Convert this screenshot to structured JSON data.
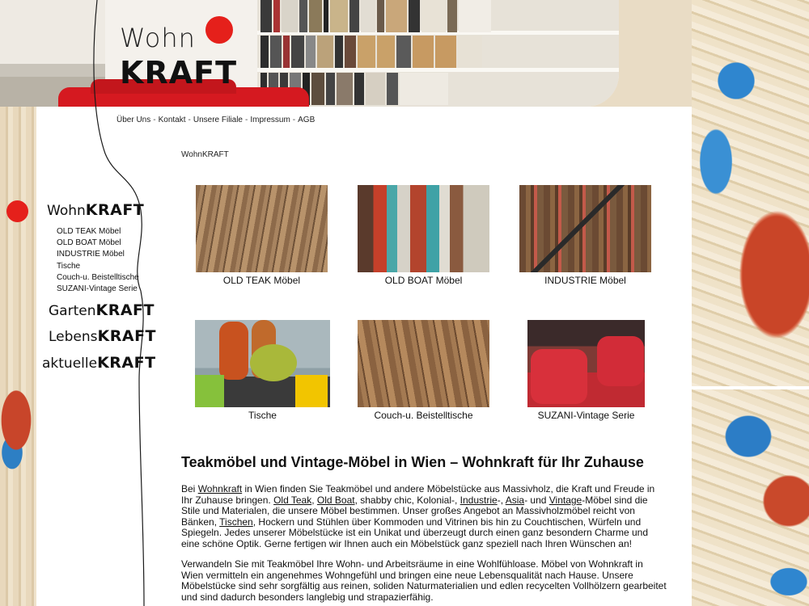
{
  "header": {
    "logo_wohn": "Wohn",
    "logo_kraft": "KRAFT"
  },
  "topnav": {
    "items": [
      {
        "label": "Über Uns"
      },
      {
        "label": "Kontakt"
      },
      {
        "label": "Unsere Filiale"
      },
      {
        "label": "Impressum"
      },
      {
        "label": "AGB"
      }
    ],
    "separator": "-"
  },
  "breadcrumb": "WohnKRAFT",
  "sidebar": {
    "wohn": {
      "thin": "Wohn",
      "bold": "KRAFT"
    },
    "sub_items": [
      "OLD TEAK Möbel",
      "OLD BOAT Möbel",
      "INDUSTRIE Möbel",
      "Tische",
      "Couch-u. Beistelltische",
      "SUZANI-Vintage Serie"
    ],
    "garten": {
      "thin": "Garten",
      "bold": "KRAFT"
    },
    "lebens": {
      "thin": "Lebens",
      "bold": "KRAFT"
    },
    "aktuelle": {
      "thin": "aktuelle",
      "bold": "KRAFT"
    }
  },
  "gallery": [
    {
      "caption": "OLD TEAK Möbel"
    },
    {
      "caption": "OLD BOAT Möbel"
    },
    {
      "caption": "INDUSTRIE Möbel"
    },
    {
      "caption": "Tische"
    },
    {
      "caption": "Couch-u. Beistelltische"
    },
    {
      "caption": "SUZANI-Vintage Serie"
    }
  ],
  "article": {
    "title": "Teakmöbel und Vintage-Möbel in Wien – Wohnkraft für Ihr Zuhause",
    "p1": {
      "t1": "Bei ",
      "l1": "Wohnkraft",
      "t2": " in Wien finden Sie Teakmöbel und andere Möbelstücke aus Massivholz, die Kraft und Freude in Ihr Zuhause bringen. ",
      "l2": "Old Teak",
      "t3": ", ",
      "l3": "Old Boat",
      "t4": ", shabby chic, Kolonial-, ",
      "l4": "Industrie",
      "t5": "-, ",
      "l5": "Asia",
      "t6": "- und ",
      "l6": "Vintage",
      "t7": "-Möbel sind die Stile und Materialen, die unsere Möbel bestimmen. Unser großes Angebot an Massivholzmöbel reicht von Bänken, ",
      "l7": "Tischen",
      "t8": ", Hockern und Stühlen über Kommoden und Vitrinen bis hin zu Couchtischen, Würfeln und Spiegeln. Jedes unserer Möbelstücke ist ein Unikat und überzeugt durch einen ganz besondern Charme und eine schöne Optik. Gerne fertigen wir Ihnen auch ein Möbelstück ganz speziell nach Ihren Wünschen an!"
    },
    "p2": "Verwandeln Sie mit Teakmöbel Ihre Wohn- und Arbeitsräume in eine Wohlfühloase. Möbel von Wohnkraft in Wien vermitteln ein angenehmes Wohngefühl und bringen eine neue Lebensqualität nach Hause. Unsere Möbelstücke sind sehr sorgfältig aus reinen, soliden Naturmaterialien und edlen recycelten Vollhölzern gearbeitet und sind dadurch besonders langlebig und strapazierfähig."
  },
  "colors": {
    "accent_red": "#e5201b",
    "text": "#111111",
    "panel": "#ffffff"
  }
}
